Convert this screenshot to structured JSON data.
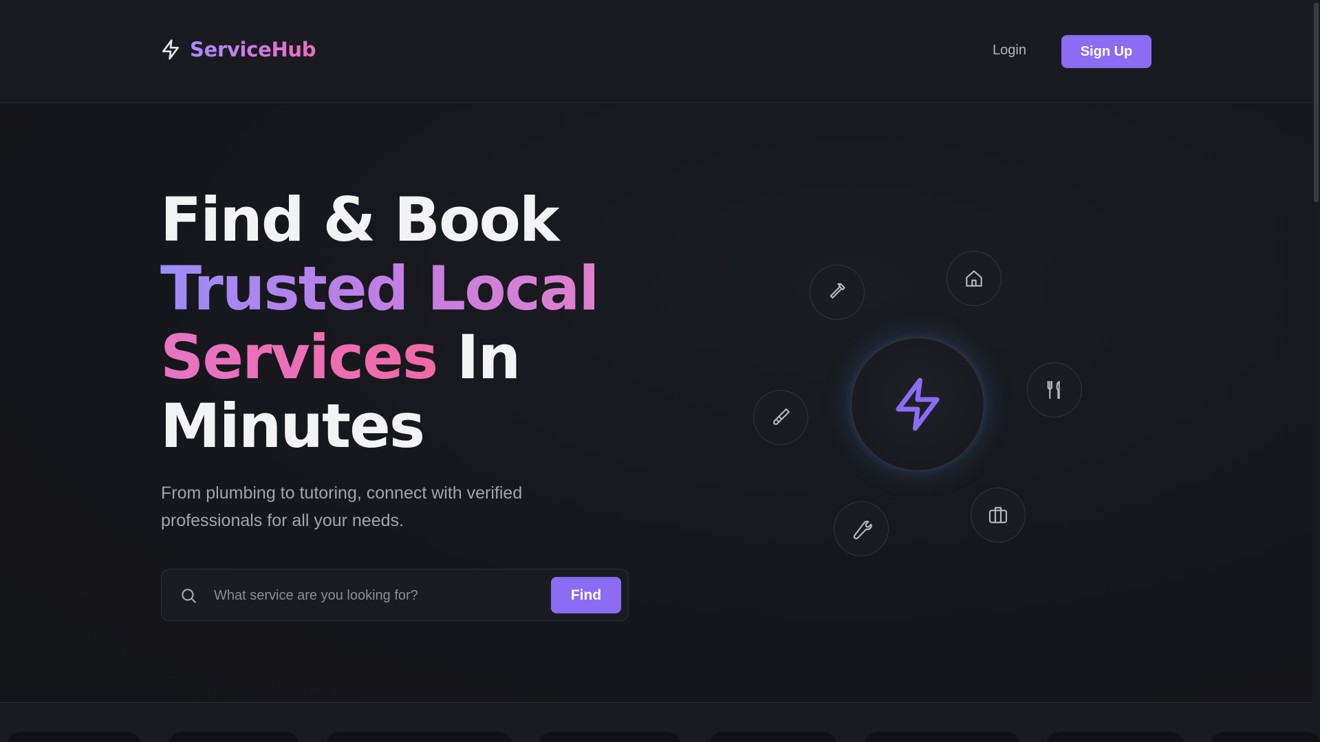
{
  "header": {
    "brand": "ServiceHub",
    "login_label": "Login",
    "signup_label": "Sign Up"
  },
  "hero": {
    "headline": {
      "line1": "Find & Book",
      "line2": "Trusted Local",
      "line3_grad": "Services",
      "line3_rest": " In",
      "line4": "Minutes"
    },
    "subtitle": "From plumbing to tutoring, connect with verified professionals for all your needs."
  },
  "search": {
    "placeholder": "What service are you looking for?",
    "value": "",
    "button_label": "Find"
  },
  "orbit_icons": [
    "hammer-icon",
    "home-icon",
    "utensils-icon",
    "briefcase-icon",
    "wrench-icon",
    "paintbrush-icon"
  ],
  "colors": {
    "accent": "#8b6cf2",
    "brand_gradient_start": "#a78bfa",
    "brand_gradient_end": "#ec6fb8",
    "background": "#16171d"
  }
}
